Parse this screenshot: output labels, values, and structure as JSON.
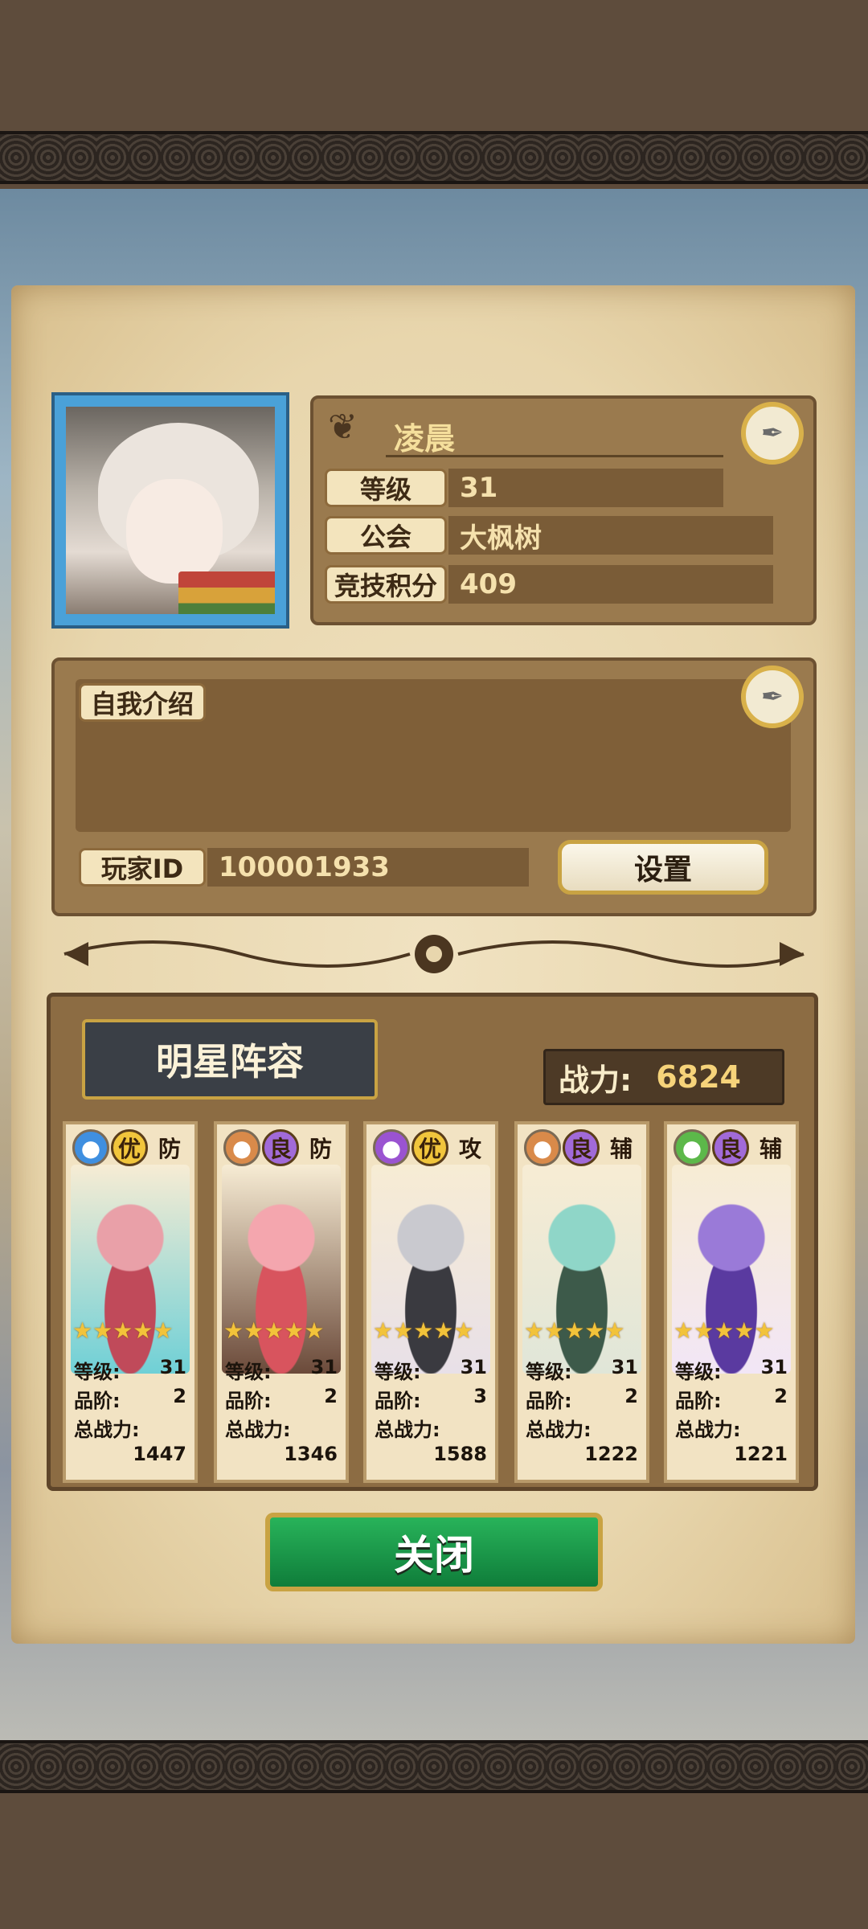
{
  "profile": {
    "name": "凌晨",
    "rows": [
      {
        "label": "等级",
        "value": "31"
      },
      {
        "label": "公会",
        "value": "大枫树"
      },
      {
        "label": "竞技积分",
        "value": "409"
      }
    ]
  },
  "intro": {
    "label": "自我介绍",
    "text": "",
    "player_id_label": "玩家ID",
    "player_id": "100001933",
    "settings_label": "设置"
  },
  "team": {
    "title": "明星阵容",
    "power_label": "战力:",
    "power_value": "6824",
    "stat_labels": {
      "level": "等级:",
      "rank": "品阶:",
      "total": "总战力:"
    },
    "cards": [
      {
        "element": "water",
        "element_color": "#3f8fe0",
        "grade": "优",
        "grade_color": "#f1c53c",
        "role": "防",
        "stars": "★★★★★",
        "level": "31",
        "rank": "2",
        "total": "1447"
      },
      {
        "element": "earth",
        "element_color": "#d98a4a",
        "grade": "良",
        "grade_color": "#a16ad8",
        "role": "防",
        "stars": "★★★★★",
        "level": "31",
        "rank": "2",
        "total": "1346"
      },
      {
        "element": "dark",
        "element_color": "#9a53d1",
        "grade": "优",
        "grade_color": "#f1c53c",
        "role": "攻",
        "stars": "★★★★★",
        "level": "31",
        "rank": "3",
        "total": "1588"
      },
      {
        "element": "earth",
        "element_color": "#d98a4a",
        "grade": "良",
        "grade_color": "#a16ad8",
        "role": "辅",
        "stars": "★★★★★",
        "level": "31",
        "rank": "2",
        "total": "1222"
      },
      {
        "element": "nature",
        "element_color": "#5cb84a",
        "grade": "良",
        "grade_color": "#a16ad8",
        "role": "辅",
        "stars": "★★★★★",
        "level": "31",
        "rank": "2",
        "total": "1221"
      }
    ]
  },
  "close_label": "关闭"
}
